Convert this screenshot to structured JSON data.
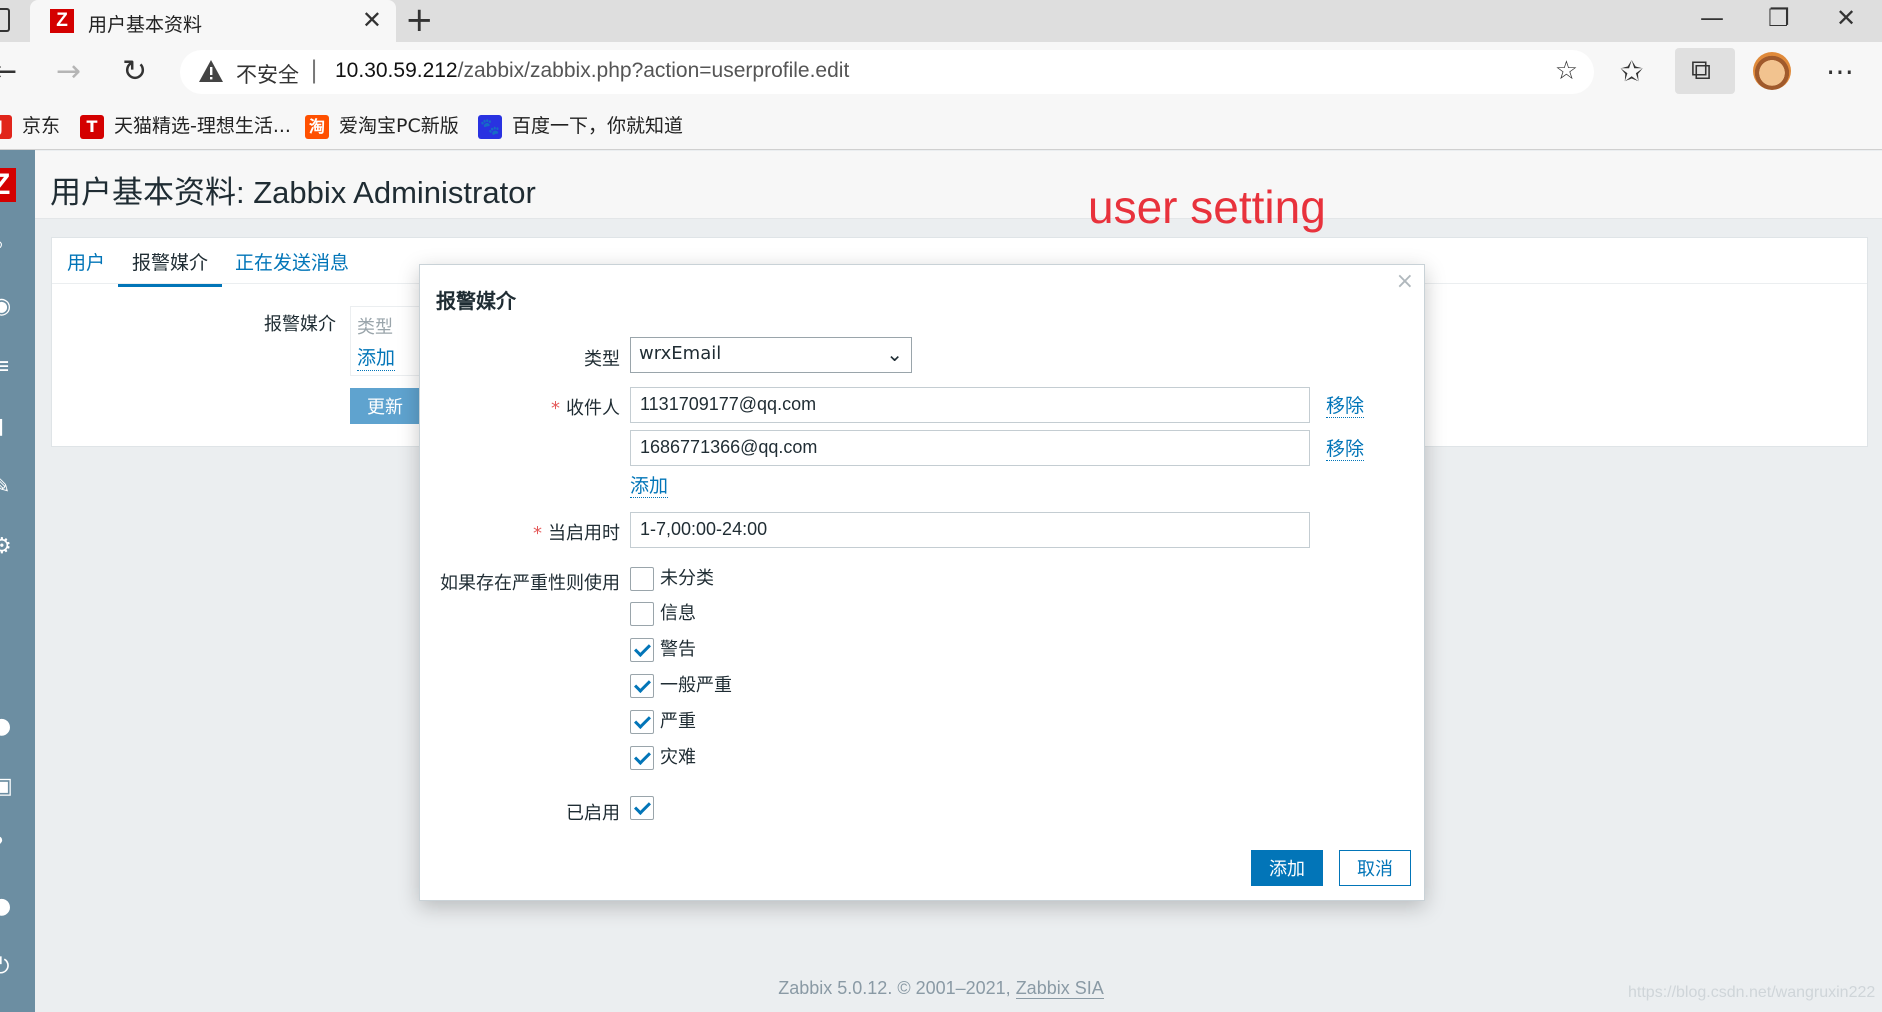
{
  "browser": {
    "tab_title": "用户基本资料",
    "tab_favicon": "Z",
    "new_tab_symbol": "+",
    "url_insecure_label": "不安全",
    "url_host": "10.30.59.212",
    "url_path": "/zabbix/zabbix.php?action=userprofile.edit",
    "bookmarks": [
      {
        "label": "京东",
        "icon": "jd-icon",
        "color": "#e1251b"
      },
      {
        "label": "天猫精选-理想生活...",
        "icon": "tmall-icon",
        "color": "#d40000"
      },
      {
        "label": "爱淘宝PC新版",
        "icon": "taobao-icon",
        "color": "#ff5000"
      },
      {
        "label": "百度一下，你就知道",
        "icon": "baidu-icon",
        "color": "#2932e1"
      }
    ]
  },
  "page": {
    "title": "用户基本资料: Zabbix Administrator",
    "annotation": "user setting",
    "tabs": [
      {
        "label": "用户",
        "active": false
      },
      {
        "label": "报警媒介",
        "active": true
      },
      {
        "label": "正在发送消息",
        "active": false
      }
    ],
    "media_label": "报警媒介",
    "media_list_header": "类型",
    "media_list_add": "添加",
    "update_button": "更新",
    "footer_prefix": "Zabbix 5.0.12. © 2001–2021, ",
    "footer_link": "Zabbix SIA",
    "watermark": "https://blog.csdn.net/wangruxin222"
  },
  "modal": {
    "title": "报警媒介",
    "close_symbol": "×",
    "type_label": "类型",
    "type_value": "wrxEmail",
    "recipient_label": "收件人",
    "recipients": [
      "1131709177@qq.com",
      "1686771366@qq.com"
    ],
    "remove_label": "移除",
    "add_recipient_label": "添加",
    "when_active_label": "当启用时",
    "when_active_value": "1-7,00:00-24:00",
    "severity_label": "如果存在严重性则使用",
    "severities": [
      {
        "label": "未分类",
        "checked": false
      },
      {
        "label": "信息",
        "checked": false
      },
      {
        "label": "警告",
        "checked": true
      },
      {
        "label": "一般严重",
        "checked": true
      },
      {
        "label": "严重",
        "checked": true
      },
      {
        "label": "灾难",
        "checked": true
      }
    ],
    "enabled_label": "已启用",
    "enabled": true,
    "add_button": "添加",
    "cancel_button": "取消",
    "required_marker": "*"
  },
  "colors": {
    "accent": "#0275b8",
    "annotation": "#e8323c",
    "sidebar": "#6c8ea2",
    "brand": "#d40000"
  }
}
